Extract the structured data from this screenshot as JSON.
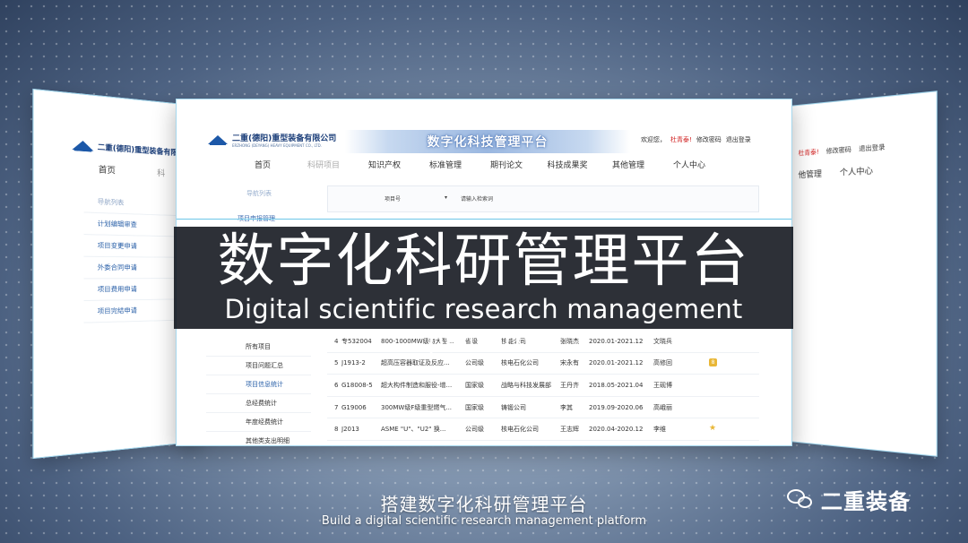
{
  "left_panel": {
    "company": "二重(德阳)重型装备有限",
    "home": "首页",
    "second": "科",
    "menu_head": "导航列表",
    "menu": [
      "计划编辑审查",
      "项目变更申请",
      "外委合同申请",
      "项目费用申请",
      "项目完结申请"
    ]
  },
  "right_panel": {
    "user_name": "杜青泰!",
    "change_password": "修改密码",
    "logout": "退出登录",
    "nav": [
      "他管理",
      "个人中心"
    ]
  },
  "main": {
    "company_name": "二重(德阳)重型装备有限公司",
    "company_sub": "ERZHONG (DEYANG) HEAVY EQUIPMENT CO., LTD.",
    "banner_title": "数字化科技管理平台",
    "welcome": "欢迎您，",
    "user_name": "杜青泰!",
    "change_password": "修改密码",
    "logout": "退出登录",
    "nav": [
      "首页",
      "科研项目",
      "知识产权",
      "标准管理",
      "期刊论文",
      "科技成果奖",
      "其他管理",
      "个人中心"
    ],
    "sidebar_head": "导航列表",
    "sidebar_sub": "项目申报管理",
    "filter_select": "项目号",
    "filter_input": "请输入检索词",
    "left_menu": [
      "所有项目",
      "项目问题汇总",
      "项目信息统计",
      "总经费统计",
      "年度经费统计",
      "其他类支出明细"
    ],
    "rows": [
      {
        "no": "4",
        "code": "专532004",
        "name": "800-1000MW级特大型...",
        "level": "省级",
        "unit": "核能公司",
        "lead": "张晓杰",
        "period": "2020.01-2021.12",
        "owner": "文晓兵",
        "badge": ""
      },
      {
        "no": "5",
        "code": "J1913-2",
        "name": "超高压容器取证及反应...",
        "level": "公司级",
        "unit": "核电石化公司",
        "lead": "宋永有",
        "period": "2020.01-2021.12",
        "owner": "高修回",
        "badge": "8"
      },
      {
        "no": "6",
        "code": "G18008-5",
        "name": "超大构件制造和服役-增...",
        "level": "国家级",
        "unit": "战略与科技发展部",
        "lead": "王丹齐",
        "period": "2018.05-2021.04",
        "owner": "王砚博",
        "badge": ""
      },
      {
        "no": "7",
        "code": "G19006",
        "name": "300MW级F级重型燃气...",
        "level": "国家级",
        "unit": "铸锻公司",
        "lead": "李其",
        "period": "2019.09-2020.06",
        "owner": "高峨丽",
        "badge": ""
      },
      {
        "no": "8",
        "code": "J2013",
        "name": "ASME \"U\"、\"U2\" 换...",
        "level": "公司级",
        "unit": "核电石化公司",
        "lead": "王志辉",
        "period": "2020.04-2020.12",
        "owner": "李维",
        "badge": "star"
      }
    ]
  },
  "overlay": {
    "title_cn": "数字化科研管理平台",
    "title_en": "Digital scientific research management platform"
  },
  "captions": {
    "cn": "搭建数字化科研管理平台",
    "en": "Build a digital scientific research management platform"
  },
  "watermark": {
    "icon": "wechat-icon",
    "text": "二重装备"
  }
}
